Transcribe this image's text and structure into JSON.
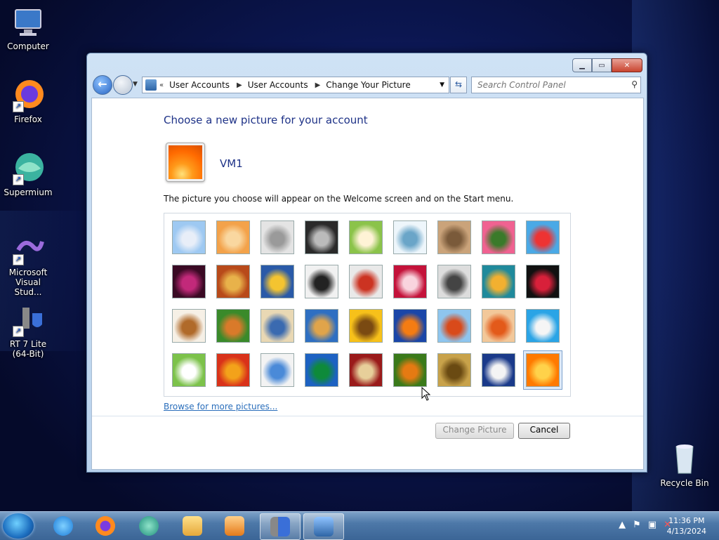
{
  "desktop": {
    "icons": [
      {
        "label": "Computer",
        "icon": "computer-icon"
      },
      {
        "label": "Firefox",
        "icon": "firefox-icon"
      },
      {
        "label": "Supermium",
        "icon": "supermium-icon"
      },
      {
        "label": "Microsoft Visual Stud...",
        "icon": "visual-studio-icon"
      },
      {
        "label": "RT 7 Lite (64-Bit)",
        "icon": "rt7lite-icon"
      },
      {
        "label": "Recycle Bin",
        "icon": "recycle-bin-icon"
      }
    ]
  },
  "window": {
    "breadcrumb": [
      "User Accounts",
      "User Accounts",
      "Change Your Picture"
    ],
    "breadcrumb_prefix": "«",
    "search_placeholder": "Search Control Panel",
    "heading": "Choose a new picture for your account",
    "username": "VM1",
    "description": "The picture you choose will appear on the Welcome screen and on the Start menu.",
    "browse_link": "Browse for more pictures...",
    "change_button": "Change Picture",
    "cancel_button": "Cancel",
    "pictures": [
      "roller-coaster",
      "starfish",
      "robot-toy",
      "record-player",
      "lucky-cat",
      "gyroscope",
      "kitten",
      "pink-flower",
      "ferris-wheel",
      "ball",
      "fabric",
      "yellow-leaf",
      "dog",
      "crayons",
      "paper-star",
      "jacks",
      "stairs",
      "paper-crane",
      "guitar",
      "pomeranian",
      "tin-robot",
      "scarves",
      "sunflower",
      "fish",
      "hot-air-balloon",
      "doll",
      "sailboat",
      "soccer-ball",
      "striped-cloth",
      "marbles",
      "window",
      "woven-fabric",
      "butterfly",
      "basket",
      "lighthouse",
      "orange-flower"
    ],
    "selected_picture": "orange-flower"
  },
  "taskbar": {
    "items": [
      "start-orb",
      "internet-explorer-icon",
      "firefox-icon",
      "supermium-icon",
      "file-explorer-icon",
      "media-player-icon",
      "rt7lite-icon",
      "control-panel-icon"
    ],
    "time": "11:36 PM",
    "date": "4/13/2024"
  },
  "colors": {
    "accent": "#1e3287",
    "link": "#2a6ebb"
  }
}
